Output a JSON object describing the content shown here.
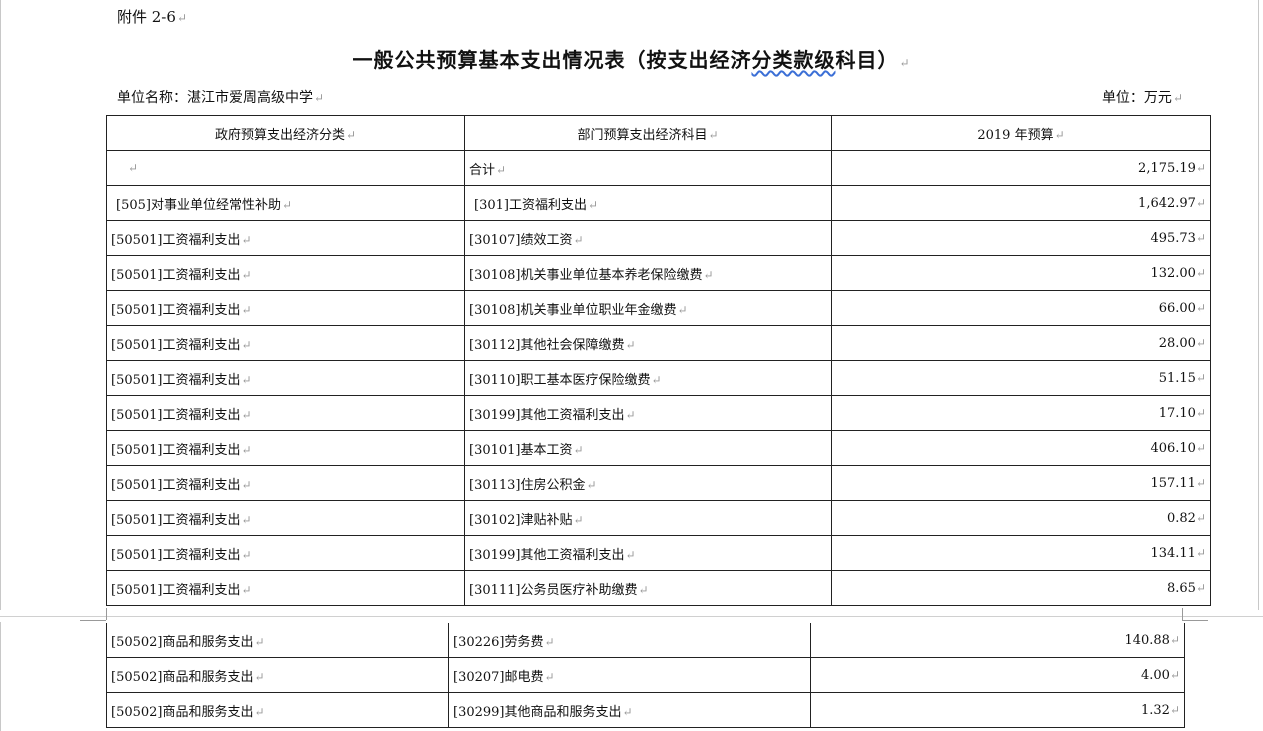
{
  "document": {
    "attachment": "附件 2-6",
    "title_main": "一般公共预算基本支出情况表（按支出经济",
    "title_wavy": "分类款级",
    "title_end": "科目）",
    "unit_name": "单位名称：湛江市爱周高级中学",
    "unit_measure": "单位：万元",
    "para_mark": "↵"
  },
  "table": {
    "headers": [
      "政府预算支出经济分类",
      "部门预算支出经济科目",
      "2019 年预算"
    ],
    "rows_page1": [
      {
        "gov": "",
        "dept": "合计",
        "amount": "2,175.19"
      },
      {
        "gov": "[505]对事业单位经常性补助",
        "dept": "[301]工资福利支出",
        "amount": "1,642.97"
      },
      {
        "gov": "[50501]工资福利支出",
        "dept": "[30107]绩效工资",
        "amount": "495.73"
      },
      {
        "gov": "[50501]工资福利支出",
        "dept": "[30108]机关事业单位基本养老保险缴费",
        "amount": "132.00"
      },
      {
        "gov": "[50501]工资福利支出",
        "dept": "[30108]机关事业单位职业年金缴费",
        "amount": "66.00"
      },
      {
        "gov": "[50501]工资福利支出",
        "dept": "[30112]其他社会保障缴费",
        "amount": "28.00"
      },
      {
        "gov": "[50501]工资福利支出",
        "dept": "[30110]职工基本医疗保险缴费",
        "amount": "51.15"
      },
      {
        "gov": "[50501]工资福利支出",
        "dept": "[30199]其他工资福利支出",
        "amount": "17.10"
      },
      {
        "gov": "[50501]工资福利支出",
        "dept": "[30101]基本工资",
        "amount": "406.10"
      },
      {
        "gov": "[50501]工资福利支出",
        "dept": "[30113]住房公积金",
        "amount": "157.11"
      },
      {
        "gov": "[50501]工资福利支出",
        "dept": "[30102]津贴补贴",
        "amount": "0.82"
      },
      {
        "gov": "[50501]工资福利支出",
        "dept": "[30199]其他工资福利支出",
        "amount": "134.11"
      },
      {
        "gov": "[50501]工资福利支出",
        "dept": "[30111]公务员医疗补助缴费",
        "amount": "8.65"
      }
    ],
    "rows_page2": [
      {
        "gov": "[50502]商品和服务支出",
        "dept": "[30226]劳务费",
        "amount": "140.88"
      },
      {
        "gov": "[50502]商品和服务支出",
        "dept": "[30207]邮电费",
        "amount": "4.00"
      },
      {
        "gov": "[50502]商品和服务支出",
        "dept": "[30299]其他商品和服务支出",
        "amount": "1.32"
      }
    ]
  }
}
